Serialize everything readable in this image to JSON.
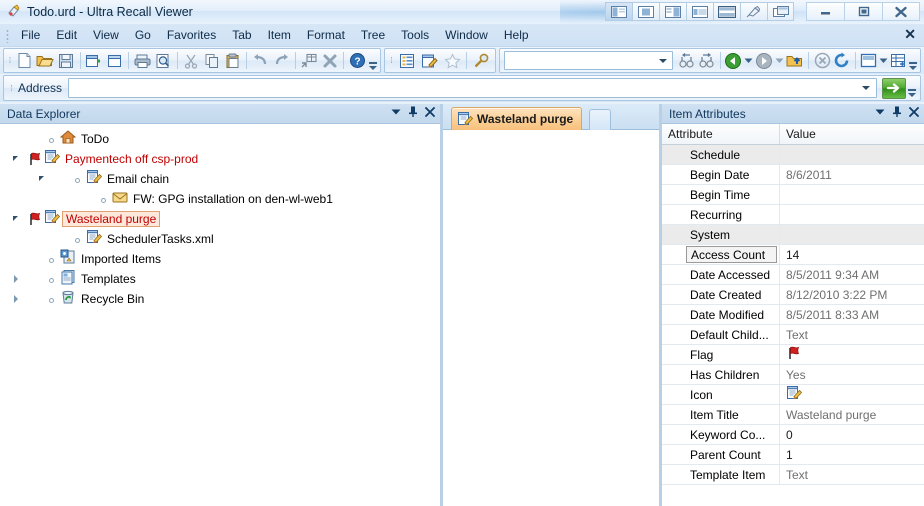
{
  "window": {
    "title": "Todo.urd - Ultra Recall Viewer",
    "app_icon": "ultrarecall-icon",
    "layout_buttons": [
      {
        "name": "layout-left-panel",
        "selected": true
      },
      {
        "name": "layout-center-panel",
        "selected": false
      },
      {
        "name": "layout-right-panel",
        "selected": false
      },
      {
        "name": "layout-wide-panel",
        "selected": false
      },
      {
        "name": "layout-split-horizontal",
        "selected": false
      },
      {
        "name": "layout-pin",
        "selected": false
      },
      {
        "name": "layout-cascade",
        "selected": false
      }
    ],
    "controls": [
      {
        "name": "minimize-button",
        "glyph": "–"
      },
      {
        "name": "maximize-button",
        "glyph": "□"
      },
      {
        "name": "close-button",
        "glyph": "✕"
      }
    ]
  },
  "menu": {
    "items": [
      "File",
      "Edit",
      "View",
      "Go",
      "Favorites",
      "Tab",
      "Item",
      "Format",
      "Tree",
      "Tools",
      "Window",
      "Help"
    ],
    "close_glyph": "✕"
  },
  "toolbar": {
    "group1": [
      {
        "name": "new-document-button",
        "icon": "new-document-icon"
      },
      {
        "name": "open-folder-button",
        "icon": "open-folder-icon"
      },
      {
        "name": "save-button",
        "icon": "save-icon"
      },
      {
        "name": "new-item-button",
        "icon": "new-item-icon"
      },
      {
        "name": "new-child-item-button",
        "icon": "new-child-item-icon"
      },
      {
        "name": "print-button",
        "icon": "printer-icon"
      },
      {
        "name": "print-preview-button",
        "icon": "print-preview-icon"
      },
      {
        "name": "cut-button",
        "icon": "scissors-icon"
      },
      {
        "name": "copy-button",
        "icon": "copy-icon"
      },
      {
        "name": "paste-button",
        "icon": "clipboard-paste-icon"
      },
      {
        "name": "undo-button",
        "icon": "undo-arrow-icon"
      },
      {
        "name": "redo-button",
        "icon": "redo-arrow-icon"
      },
      {
        "name": "insert-item-button",
        "icon": "insert-item-icon"
      },
      {
        "name": "delete-button",
        "icon": "delete-x-icon"
      },
      {
        "name": "help-button",
        "icon": "help-circle-icon"
      }
    ],
    "group2": [
      {
        "name": "outline-view-button",
        "icon": "outline-list-icon"
      },
      {
        "name": "edit-item-button",
        "icon": "edit-pencil-icon"
      },
      {
        "name": "favorite-button",
        "icon": "star-icon"
      },
      {
        "name": "search-button",
        "icon": "magnifier-icon"
      }
    ],
    "search_value": "",
    "group3": [
      {
        "name": "find-previous-button",
        "icon": "binoculars-back-icon"
      },
      {
        "name": "find-next-button",
        "icon": "binoculars-forward-icon"
      },
      {
        "name": "back-button",
        "icon": "back-arrow-icon"
      },
      {
        "name": "back-dropdown",
        "icon": "chevron-down-icon"
      },
      {
        "name": "forward-button",
        "icon": "forward-arrow-icon"
      },
      {
        "name": "forward-dropdown",
        "icon": "chevron-down-icon"
      },
      {
        "name": "up-level-button",
        "icon": "folder-up-icon"
      },
      {
        "name": "stop-button",
        "icon": "stop-circle-icon"
      },
      {
        "name": "refresh-button",
        "icon": "refresh-icon"
      },
      {
        "name": "pane-layout-button",
        "icon": "pane-layout-icon"
      },
      {
        "name": "pane-layout-dropdown",
        "icon": "chevron-down-icon"
      },
      {
        "name": "grid-view-button",
        "icon": "grid-view-icon"
      }
    ]
  },
  "address": {
    "label": "Address",
    "value": "",
    "go_icon": "green-arrow-go-icon"
  },
  "explorer": {
    "title": "Data Explorer",
    "buttons": [
      {
        "name": "panel-menu-dropdown",
        "glyph": "▼"
      },
      {
        "name": "panel-pin",
        "glyph": "⚐"
      },
      {
        "name": "panel-close",
        "glyph": "✕"
      }
    ],
    "nodes": [
      {
        "label": "ToDo",
        "icon": "home-icon",
        "depth": 0,
        "expander": "none",
        "style": "normal",
        "flag": false
      },
      {
        "label": "Paymentech off csp-prod",
        "icon": "document-edit-icon",
        "depth": 0,
        "expander": "open",
        "style": "red",
        "flag": true
      },
      {
        "label": "Email chain",
        "icon": "document-edit-icon",
        "depth": 1,
        "expander": "open",
        "style": "normal",
        "flag": false
      },
      {
        "label": "FW: GPG installation on den-wl-web1",
        "icon": "envelope-icon",
        "depth": 2,
        "expander": "none",
        "style": "normal",
        "flag": false
      },
      {
        "label": "Wasteland purge",
        "icon": "document-edit-icon",
        "depth": 0,
        "expander": "open",
        "style": "selected",
        "flag": true
      },
      {
        "label": "SchedulerTasks.xml",
        "icon": "document-edit-icon",
        "depth": 1,
        "expander": "none",
        "style": "normal",
        "flag": false
      },
      {
        "label": "Imported Items",
        "icon": "imported-items-icon",
        "depth": 0,
        "expander": "none",
        "style": "normal",
        "flag": false
      },
      {
        "label": "Templates",
        "icon": "templates-icon",
        "depth": 0,
        "expander": "closed",
        "style": "normal",
        "flag": false
      },
      {
        "label": "Recycle Bin",
        "icon": "recycle-bin-icon",
        "depth": 0,
        "expander": "closed",
        "style": "normal",
        "flag": false
      }
    ]
  },
  "center": {
    "active_tab": {
      "label": "Wasteland purge",
      "icon": "document-edit-icon"
    },
    "extra_tab": {
      "label": "",
      "name": "tab-stub"
    }
  },
  "attributes": {
    "title": "Item Attributes",
    "buttons": [
      {
        "name": "panel-menu-dropdown",
        "glyph": "▼"
      },
      {
        "name": "panel-pin",
        "glyph": "⚐"
      },
      {
        "name": "panel-close",
        "glyph": "✕"
      }
    ],
    "columns": [
      "Attribute",
      "Value"
    ],
    "rows": [
      {
        "attribute": "Schedule",
        "value": "",
        "group": true,
        "focused": false,
        "icon": ""
      },
      {
        "attribute": "Begin Date",
        "value": "8/6/2011",
        "group": false,
        "focused": false,
        "icon": ""
      },
      {
        "attribute": "Begin Time",
        "value": "",
        "group": false,
        "focused": false,
        "icon": ""
      },
      {
        "attribute": "Recurring",
        "value": "",
        "group": false,
        "focused": false,
        "icon": ""
      },
      {
        "attribute": "System",
        "value": "",
        "group": true,
        "focused": false,
        "icon": ""
      },
      {
        "attribute": "Access Count",
        "value": "14",
        "group": false,
        "focused": true,
        "icon": ""
      },
      {
        "attribute": "Date Accessed",
        "value": "8/5/2011 9:34 AM",
        "group": false,
        "focused": false,
        "icon": ""
      },
      {
        "attribute": "Date Created",
        "value": "8/12/2010 3:22 PM",
        "group": false,
        "focused": false,
        "icon": ""
      },
      {
        "attribute": "Date Modified",
        "value": "8/5/2011 8:33 AM",
        "group": false,
        "focused": false,
        "icon": ""
      },
      {
        "attribute": "Default Child...",
        "value": "Text",
        "group": false,
        "focused": false,
        "icon": ""
      },
      {
        "attribute": "Flag",
        "value": "",
        "group": false,
        "focused": false,
        "icon": "red-flag-icon"
      },
      {
        "attribute": "Has Children",
        "value": "Yes",
        "group": false,
        "focused": false,
        "icon": ""
      },
      {
        "attribute": "Icon",
        "value": "",
        "group": false,
        "focused": false,
        "icon": "document-edit-icon"
      },
      {
        "attribute": "Item Title",
        "value": "Wasteland purge",
        "group": false,
        "focused": false,
        "icon": ""
      },
      {
        "attribute": "Keyword Co...",
        "value": "0",
        "group": false,
        "focused": false,
        "icon": ""
      },
      {
        "attribute": "Parent Count",
        "value": "1",
        "group": false,
        "focused": false,
        "icon": ""
      },
      {
        "attribute": "Template Item",
        "value": "Text",
        "group": false,
        "focused": false,
        "icon": ""
      }
    ]
  },
  "colors": {
    "accent": "#0f3c66",
    "red_item": "#c00000",
    "tab_orange": "#f8c07c",
    "go_green": "#49a52b",
    "panel_blue": "#b9cfe6"
  }
}
